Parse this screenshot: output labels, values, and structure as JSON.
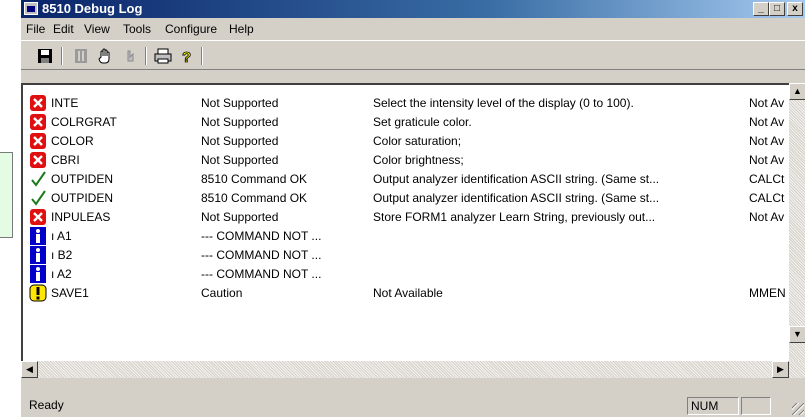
{
  "window": {
    "title": "8510 Debug Log"
  },
  "title_buttons": {
    "minimize": "_",
    "maximize": "□",
    "close": "x"
  },
  "menu": [
    {
      "label": "File"
    },
    {
      "label": "Edit"
    },
    {
      "label": "View"
    },
    {
      "label": "Tools"
    },
    {
      "label": "Configure"
    },
    {
      "label": "Help"
    }
  ],
  "toolbar": [
    {
      "icon": "save-icon"
    },
    {
      "icon": "stop-icon"
    },
    {
      "icon": "hand-icon"
    },
    {
      "icon": "step-icon"
    },
    {
      "icon": "print-icon"
    },
    {
      "icon": "help-icon"
    }
  ],
  "rows": [
    {
      "icon": "error-icon",
      "name": "INTE",
      "status": "Not Supported",
      "description": "Select the intensity level of the display (0 to 100).",
      "extra": "Not Av"
    },
    {
      "icon": "error-icon",
      "name": "COLRGRAT",
      "status": "Not Supported",
      "description": "Set graticule color.",
      "extra": "Not Av"
    },
    {
      "icon": "error-icon",
      "name": "COLOR",
      "status": "Not Supported",
      "description": "Color saturation;",
      "extra": "Not Av"
    },
    {
      "icon": "error-icon",
      "name": "CBRI",
      "status": "Not Supported",
      "description": "Color brightness;",
      "extra": "Not Av"
    },
    {
      "icon": "check-icon",
      "name": "OUTPIDEN",
      "status": "8510 Command OK",
      "description": "Output analyzer identification ASCII string. (Same st...",
      "extra": "CALCt"
    },
    {
      "icon": "check-icon",
      "name": "OUTPIDEN",
      "status": "8510 Command OK",
      "description": "Output analyzer identification ASCII string. (Same st...",
      "extra": "CALCt"
    },
    {
      "icon": "error-icon",
      "name": "INPULEAS",
      "status": "Not Supported",
      "description": "Store FORM1 analyzer Learn String, previously out...",
      "extra": "Not Av"
    },
    {
      "icon": "info-icon",
      "name": "ı A1",
      "status": "--- COMMAND NOT ...",
      "description": "",
      "extra": ""
    },
    {
      "icon": "info-icon",
      "name": "ı B2",
      "status": "--- COMMAND NOT ...",
      "description": "",
      "extra": ""
    },
    {
      "icon": "info-icon",
      "name": "ı A2",
      "status": "--- COMMAND NOT ...",
      "description": "",
      "extra": ""
    },
    {
      "icon": "warning-icon",
      "name": "SAVE1",
      "status": "Caution",
      "description": "Not Available",
      "extra": "MMEN"
    }
  ],
  "statusbar": {
    "text": "Ready",
    "num": "NUM"
  }
}
